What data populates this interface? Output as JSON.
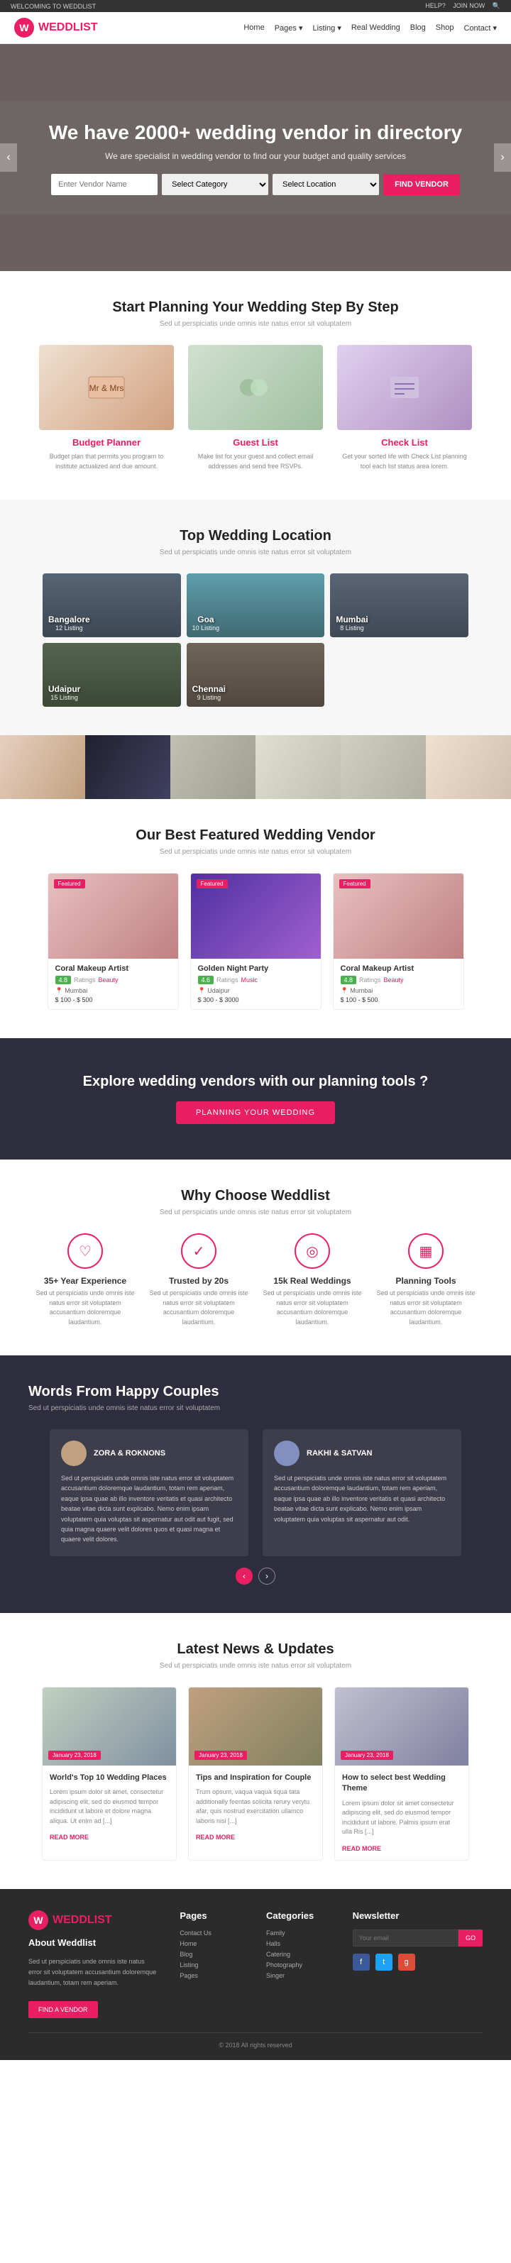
{
  "site": {
    "name": "WEDDLIST",
    "tagline": "WELCOMING TO WEDDLIST"
  },
  "topbar": {
    "tagline": "WELCOMING TO WEDDLIST",
    "help": "HELP?",
    "join_now": "JOIN NOW"
  },
  "nav": {
    "links": [
      "Home",
      "Pages",
      "Listing",
      "Real Wedding",
      "Blog",
      "Shop",
      "Contact"
    ]
  },
  "hero": {
    "heading": "We have 2000+ wedding vendor in directory",
    "subtext": "We are specialist in wedding vendor to find our your budget and quality services",
    "search_placeholder": "Enter Vendor Name",
    "category_placeholder": "Select Category",
    "location_placeholder": "Select Location",
    "search_btn": "FIND VENDOR"
  },
  "planning": {
    "title": "Start Planning Your Wedding Step By Step",
    "subtitle": "Sed ut perspiciatis unde omnis iste natus error sit voluptatem",
    "steps": [
      {
        "title": "Budget Planner",
        "text": "Budget plan that permits you program to institute actualized and due amount.",
        "img_class": "step-img-1"
      },
      {
        "title": "Guest List",
        "text": "Make list for your guest and collect email addresses and send free RSVPs.",
        "img_class": "step-img-2"
      },
      {
        "title": "Check List",
        "text": "Get your sorted life with Check List planning tool each list status area lorem.",
        "img_class": "step-img-3"
      }
    ]
  },
  "locations": {
    "title": "Top Wedding Location",
    "subtitle": "Sed ut perspiciatis unde omnis iste natus error sit voluptatem",
    "items": [
      {
        "name": "Bangalore",
        "sub": "12 Listing",
        "cls": "loc-bangalore"
      },
      {
        "name": "Goa",
        "sub": "10 Listing",
        "cls": "loc-goa"
      },
      {
        "name": "Mumbai",
        "sub": "8 Listing",
        "cls": "loc-mumbai"
      },
      {
        "name": "Udaipur",
        "sub": "15 Listing",
        "cls": "loc-udaipur"
      },
      {
        "name": "Chennai",
        "sub": "9 Listing",
        "cls": "loc-chennai"
      }
    ]
  },
  "vendors": {
    "title": "Our Best Featured Wedding Vendor",
    "subtitle": "Sed ut perspiciatis unde omnis iste natus error sit voluptatem",
    "items": [
      {
        "badge": "Featured",
        "name": "Coral Makeup Artist",
        "rating": "4.8",
        "ratings_text": "Ratings",
        "category": "Beauty",
        "location": "Mumbai",
        "price": "$ 100 - $ 500",
        "img_cls": "vendor-img-1"
      },
      {
        "badge": "Featured",
        "name": "Golden Night Party",
        "rating": "4.6",
        "ratings_text": "Ratings",
        "category": "Music",
        "location": "Udaipur",
        "price": "$ 300 - $ 3000",
        "img_cls": "vendor-img-2"
      },
      {
        "badge": "Featured",
        "name": "Coral Makeup Artist",
        "rating": "4.8",
        "ratings_text": "Ratings",
        "category": "Beauty",
        "location": "Mumbai",
        "price": "$ 100 - $ 500",
        "img_cls": "vendor-img-3"
      }
    ]
  },
  "cta": {
    "text": "Explore wedding vendors with our planning tools ?",
    "btn": "PLANNING YOUR WEDDING"
  },
  "why": {
    "title": "Why Choose Weddlist",
    "subtitle": "Sed ut perspiciatis unde omnis iste natus error sit voluptatem",
    "items": [
      {
        "icon": "♡",
        "title": "35+ Year Experience",
        "text": "Sed ut perspiciatis unde omnis iste natus error sit voluptatem accusantium doloremque laudantium."
      },
      {
        "icon": "✓",
        "title": "Trusted by 20s",
        "text": "Sed ut perspiciatis unde omnis iste natus error sit voluptatem accusantium doloremque laudantium."
      },
      {
        "icon": "◎",
        "title": "15k Real Weddings",
        "text": "Sed ut perspiciatis unde omnis iste natus error sit voluptatem accusantium doloremque laudantium."
      },
      {
        "icon": "▦",
        "title": "Planning Tools",
        "text": "Sed ut perspiciatis unde omnis iste natus error sit voluptatem accusantium doloremque laudantium."
      }
    ]
  },
  "testimonials": {
    "title": "Words From Happy Couples",
    "subtitle": "Sed ut perspiciatis unde omnis iste natus error sit voluptatem",
    "items": [
      {
        "name": "ZORA & ROKNONS",
        "role": "",
        "text": "Sed ut perspiciatis unde omnis iste natus error sit voluptatem accusantium doloremque laudantium, totam rem aperiam, eaque ipsa quae ab illo inventore veritatis et quasi architecto beatae vitae dicta sunt explicabo. Nemo enim ipsam voluptatem quia voluptas sit aspernatur aut odit aut fugit, sed quia magna quaere velit dolores quos et quasi magna et quaere velit dolores.",
        "avatar_cls": "t-avatar"
      },
      {
        "name": "RAKHI & SATVAN",
        "role": "",
        "text": "Sed ut perspiciatis unde omnis iste natus error sit voluptatem accusantium doloremque laudantium, totam rem aperiam, eaque ipsa quae ab illo inventore veritatis et quasi architecto beatae vitae dicta sunt explicabo. Nemo enim ipsam voluptatem quia voluptas sit aspernatur aut odit.",
        "avatar_cls": "t-avatar t-avatar-2"
      }
    ],
    "nav_prev": "‹",
    "nav_next": "›"
  },
  "news": {
    "title": "Latest News & Updates",
    "subtitle": "Sed ut perspiciatis unde omnis iste natus error sit voluptatem",
    "items": [
      {
        "date": "January 23, 2018",
        "title": "World's Top 10 Wedding Places",
        "text": "Lorem ipsum dolor sit amet, consectetur adipiscing elit, sed do eiusmod tempor incididunt ut labore et dolore magna aliqua. Ut enim ad [...]",
        "read_more": "READ MORE",
        "img_cls": "news-img-1"
      },
      {
        "date": "January 23, 2018",
        "title": "Tips and Inspiration for Couple",
        "text": "Trum opsum, vaqua vaqua squa tata additionally feentas solicita rerury verytu afar, quis nostrud exercitation ullamco laboris nisi [...]",
        "read_more": "READ MORE",
        "img_cls": "news-img-2"
      },
      {
        "date": "January 23, 2018",
        "title": "How to select best Wedding Theme",
        "text": "Lorem ipsum dolor sit amet consectetur adipiscing elit, sed do eiusmod tempor incididunt ut labore. Palmis ipsum erat ulla Ris [...]",
        "read_more": "READ MORE",
        "img_cls": "news-img-3"
      }
    ]
  },
  "footer": {
    "about_title": "About Weddlist",
    "about_text": "Sed ut perspiciatis unde omnis iste natus error sit voluptatem accusantium doloremque laudantium, totam rem aperiam.",
    "find_btn": "FIND A VENDOR",
    "pages_title": "Pages",
    "pages_links": [
      "Contact Us",
      "Home",
      "Blog",
      "Listing",
      "Pages"
    ],
    "categories_title": "Categories",
    "categories_links": [
      "Family",
      "Halls",
      "Catering",
      "Photography",
      "Singer"
    ],
    "newsletter_title": "Newsletter",
    "newsletter_placeholder": "Your email",
    "newsletter_btn": "GO",
    "social_links": [
      "f",
      "t",
      "g"
    ],
    "copyright": "© 2018 All rights reserved"
  }
}
